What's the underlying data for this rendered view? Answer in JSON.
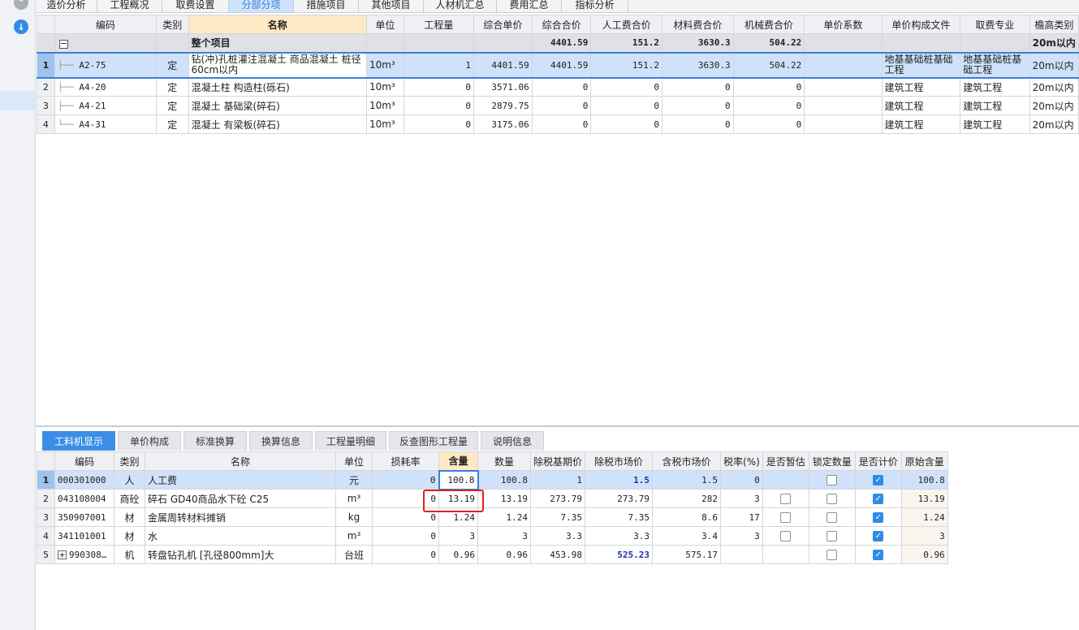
{
  "top_tabs": [
    "造价分析",
    "工程概况",
    "取费设置",
    "分部分项",
    "措施项目",
    "其他项目",
    "人材机汇总",
    "费用汇总",
    "指标分析"
  ],
  "top_tabs_active": "分部分项",
  "top_table": {
    "headers": [
      "编码",
      "类别",
      "名称",
      "单位",
      "工程量",
      "综合单价",
      "综合合价",
      "人工费合价",
      "材料费合价",
      "机械费合价",
      "单价系数",
      "单价构成文件",
      "取费专业",
      "檐高类别"
    ],
    "total": {
      "name": "整个项目",
      "zhhj": "4401.59",
      "rgf": "151.2",
      "clf": "3630.3",
      "jxf": "504.22",
      "yg": "20m以内"
    },
    "rows": [
      {
        "n": "1",
        "code": "A2-75",
        "type": "定",
        "name": "钻(冲)孔桩灌注混凝土 商品混凝土 桩径60cm以内",
        "unit": "10m³",
        "qty": "1",
        "zhdj": "4401.59",
        "zhhj": "4401.59",
        "rgf": "151.2",
        "clf": "3630.3",
        "jxf": "504.22",
        "xs": "",
        "gcwj": "地基基础桩基础工程",
        "qfzy": "地基基础桩基础工程",
        "yg": "20m以内"
      },
      {
        "n": "2",
        "code": "A4-20",
        "type": "定",
        "name": "混凝土柱 构造柱(砾石)",
        "unit": "10m³",
        "qty": "0",
        "zhdj": "3571.06",
        "zhhj": "0",
        "rgf": "0",
        "clf": "0",
        "jxf": "0",
        "xs": "",
        "gcwj": "建筑工程",
        "qfzy": "建筑工程",
        "yg": "20m以内"
      },
      {
        "n": "3",
        "code": "A4-21",
        "type": "定",
        "name": "混凝土 基础梁(碎石)",
        "unit": "10m³",
        "qty": "0",
        "zhdj": "2879.75",
        "zhhj": "0",
        "rgf": "0",
        "clf": "0",
        "jxf": "0",
        "xs": "",
        "gcwj": "建筑工程",
        "qfzy": "建筑工程",
        "yg": "20m以内"
      },
      {
        "n": "4",
        "code": "A4-31",
        "type": "定",
        "name": "混凝土 有梁板(碎石)",
        "unit": "10m³",
        "qty": "0",
        "zhdj": "3175.06",
        "zhhj": "0",
        "rgf": "0",
        "clf": "0",
        "jxf": "0",
        "xs": "",
        "gcwj": "建筑工程",
        "qfzy": "建筑工程",
        "yg": "20m以内"
      }
    ]
  },
  "bottom_tabs": [
    "工料机显示",
    "单价构成",
    "标准换算",
    "换算信息",
    "工程量明细",
    "反查图形工程量",
    "说明信息"
  ],
  "bottom_tabs_active": "工料机显示",
  "bottom_table": {
    "headers": [
      "编码",
      "类别",
      "名称",
      "单位",
      "损耗率",
      "含量",
      "数量",
      "除税基期价",
      "除税市场价",
      "含税市场价",
      "税率(%)",
      "是否暂估",
      "锁定数量",
      "是否计价",
      "原始含量"
    ],
    "rows": [
      {
        "n": "1",
        "code": "000301000",
        "type": "人",
        "name": "人工费",
        "unit": "元",
        "shl": "0",
        "hl": "100.8",
        "sl": "100.8",
        "jqj": "1",
        "scj": "1.5",
        "hsj": "1.5",
        "sv": "0",
        "zg": null,
        "sd": false,
        "jj": true,
        "yshl": "100.8"
      },
      {
        "n": "2",
        "code": "043108004",
        "type": "商砼",
        "name": "碎石 GD40商品水下砼 C25",
        "unit": "m³",
        "shl": "0",
        "hl": "13.19",
        "sl": "13.19",
        "jqj": "273.79",
        "scj": "273.79",
        "hsj": "282",
        "sv": "3",
        "zg": false,
        "sd": false,
        "jj": true,
        "yshl": "13.19"
      },
      {
        "n": "3",
        "code": "350907001",
        "type": "材",
        "name": "金属周转材料摊销",
        "unit": "kg",
        "shl": "0",
        "hl": "1.24",
        "sl": "1.24",
        "jqj": "7.35",
        "scj": "7.35",
        "hsj": "8.6",
        "sv": "17",
        "zg": false,
        "sd": false,
        "jj": true,
        "yshl": "1.24"
      },
      {
        "n": "4",
        "code": "341101001",
        "type": "材",
        "name": "水",
        "unit": "m³",
        "shl": "0",
        "hl": "3",
        "sl": "3",
        "jqj": "3.3",
        "scj": "3.3",
        "hsj": "3.4",
        "sv": "3",
        "zg": false,
        "sd": false,
        "jj": true,
        "yshl": "3"
      },
      {
        "n": "5",
        "code": "990308…",
        "type": "机",
        "name": "转盘钻孔机 [孔径800mm]大",
        "unit": "台班",
        "shl": "0",
        "hl": "0.96",
        "sl": "0.96",
        "jqj": "453.98",
        "scj": "525.23",
        "hsj": "575.17",
        "sv": "",
        "zg": null,
        "sd": false,
        "jj": true,
        "yshl": "0.96"
      }
    ]
  },
  "colors": {
    "accent": "#3a8ee6",
    "selection": "#cfe2fa",
    "highlight_box": "#e02020",
    "header_highlight": "#fde9c4"
  },
  "icons": {
    "rail_top": "collapse-icon",
    "rail_second": "download-icon"
  }
}
